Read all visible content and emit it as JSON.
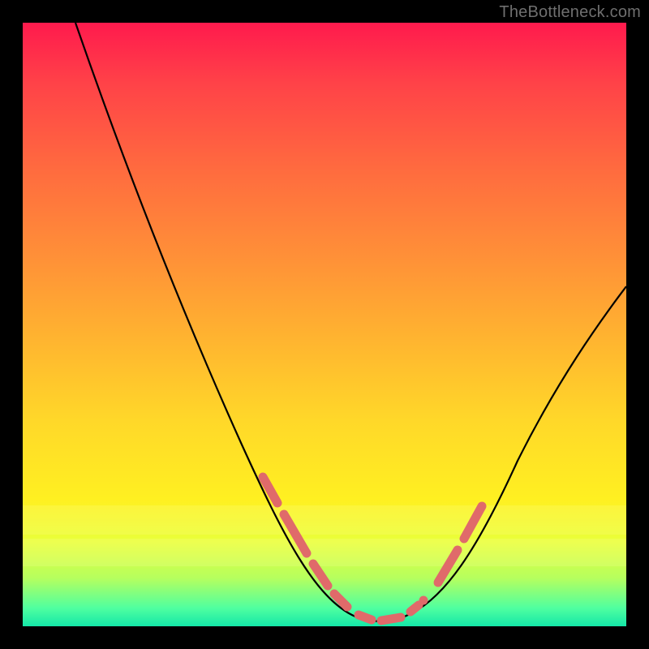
{
  "watermark": "TheBottleneck.com",
  "colors": {
    "background": "#000000",
    "curve_main": "#000000",
    "curve_accent": "#e06a6a",
    "gradient_top": "#ff1a4d",
    "gradient_bottom": "#14e7a8"
  },
  "chart_data": {
    "type": "line",
    "title": "",
    "xlabel": "",
    "ylabel": "",
    "xlim": [
      0,
      100
    ],
    "ylim": [
      0,
      100
    ],
    "grid": false,
    "legend": false,
    "series": [
      {
        "name": "bottleneck-curve",
        "color": "#000000",
        "x": [
          10,
          15,
          20,
          25,
          30,
          35,
          40,
          45,
          50,
          53,
          56,
          60,
          62,
          65,
          70,
          75,
          80,
          85,
          90,
          95,
          100
        ],
        "y": [
          100,
          90,
          78,
          66,
          54,
          42,
          31,
          21,
          11,
          5,
          2,
          1,
          1,
          2,
          8,
          18,
          28,
          37,
          45,
          52,
          58
        ]
      },
      {
        "name": "highlight-segments",
        "color": "#e06a6a",
        "segments": [
          {
            "x": [
              40,
              43
            ],
            "y": [
              31,
              25
            ]
          },
          {
            "x": [
              44,
              49
            ],
            "y": [
              23,
              13
            ]
          },
          {
            "x": [
              50,
              52
            ],
            "y": [
              11,
              6
            ]
          },
          {
            "x": [
              53,
              55
            ],
            "y": [
              5,
              3
            ]
          },
          {
            "x": [
              57,
              59
            ],
            "y": [
              2,
              1
            ]
          },
          {
            "x": [
              60,
              63
            ],
            "y": [
              1,
              1.5
            ]
          },
          {
            "x": [
              65,
              66
            ],
            "y": [
              2,
              3
            ]
          },
          {
            "x": [
              69,
              72
            ],
            "y": [
              7,
              12
            ]
          },
          {
            "x": [
              73,
              76
            ],
            "y": [
              14,
              20
            ]
          },
          {
            "x": [
              66.5,
              66.5
            ],
            "y": [
              3,
              3
            ]
          }
        ]
      }
    ]
  }
}
